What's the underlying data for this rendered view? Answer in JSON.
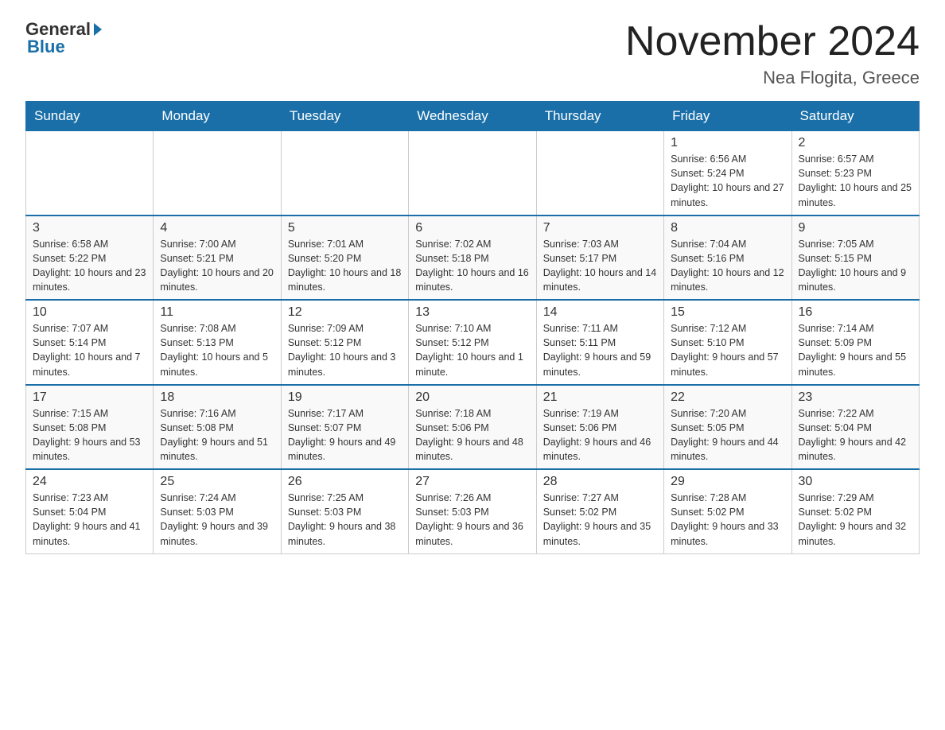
{
  "header": {
    "logo_general": "General",
    "logo_blue": "Blue",
    "month_year": "November 2024",
    "location": "Nea Flogita, Greece"
  },
  "weekdays": [
    "Sunday",
    "Monday",
    "Tuesday",
    "Wednesday",
    "Thursday",
    "Friday",
    "Saturday"
  ],
  "weeks": [
    [
      {
        "day": "",
        "info": ""
      },
      {
        "day": "",
        "info": ""
      },
      {
        "day": "",
        "info": ""
      },
      {
        "day": "",
        "info": ""
      },
      {
        "day": "",
        "info": ""
      },
      {
        "day": "1",
        "info": "Sunrise: 6:56 AM\nSunset: 5:24 PM\nDaylight: 10 hours and 27 minutes."
      },
      {
        "day": "2",
        "info": "Sunrise: 6:57 AM\nSunset: 5:23 PM\nDaylight: 10 hours and 25 minutes."
      }
    ],
    [
      {
        "day": "3",
        "info": "Sunrise: 6:58 AM\nSunset: 5:22 PM\nDaylight: 10 hours and 23 minutes."
      },
      {
        "day": "4",
        "info": "Sunrise: 7:00 AM\nSunset: 5:21 PM\nDaylight: 10 hours and 20 minutes."
      },
      {
        "day": "5",
        "info": "Sunrise: 7:01 AM\nSunset: 5:20 PM\nDaylight: 10 hours and 18 minutes."
      },
      {
        "day": "6",
        "info": "Sunrise: 7:02 AM\nSunset: 5:18 PM\nDaylight: 10 hours and 16 minutes."
      },
      {
        "day": "7",
        "info": "Sunrise: 7:03 AM\nSunset: 5:17 PM\nDaylight: 10 hours and 14 minutes."
      },
      {
        "day": "8",
        "info": "Sunrise: 7:04 AM\nSunset: 5:16 PM\nDaylight: 10 hours and 12 minutes."
      },
      {
        "day": "9",
        "info": "Sunrise: 7:05 AM\nSunset: 5:15 PM\nDaylight: 10 hours and 9 minutes."
      }
    ],
    [
      {
        "day": "10",
        "info": "Sunrise: 7:07 AM\nSunset: 5:14 PM\nDaylight: 10 hours and 7 minutes."
      },
      {
        "day": "11",
        "info": "Sunrise: 7:08 AM\nSunset: 5:13 PM\nDaylight: 10 hours and 5 minutes."
      },
      {
        "day": "12",
        "info": "Sunrise: 7:09 AM\nSunset: 5:12 PM\nDaylight: 10 hours and 3 minutes."
      },
      {
        "day": "13",
        "info": "Sunrise: 7:10 AM\nSunset: 5:12 PM\nDaylight: 10 hours and 1 minute."
      },
      {
        "day": "14",
        "info": "Sunrise: 7:11 AM\nSunset: 5:11 PM\nDaylight: 9 hours and 59 minutes."
      },
      {
        "day": "15",
        "info": "Sunrise: 7:12 AM\nSunset: 5:10 PM\nDaylight: 9 hours and 57 minutes."
      },
      {
        "day": "16",
        "info": "Sunrise: 7:14 AM\nSunset: 5:09 PM\nDaylight: 9 hours and 55 minutes."
      }
    ],
    [
      {
        "day": "17",
        "info": "Sunrise: 7:15 AM\nSunset: 5:08 PM\nDaylight: 9 hours and 53 minutes."
      },
      {
        "day": "18",
        "info": "Sunrise: 7:16 AM\nSunset: 5:08 PM\nDaylight: 9 hours and 51 minutes."
      },
      {
        "day": "19",
        "info": "Sunrise: 7:17 AM\nSunset: 5:07 PM\nDaylight: 9 hours and 49 minutes."
      },
      {
        "day": "20",
        "info": "Sunrise: 7:18 AM\nSunset: 5:06 PM\nDaylight: 9 hours and 48 minutes."
      },
      {
        "day": "21",
        "info": "Sunrise: 7:19 AM\nSunset: 5:06 PM\nDaylight: 9 hours and 46 minutes."
      },
      {
        "day": "22",
        "info": "Sunrise: 7:20 AM\nSunset: 5:05 PM\nDaylight: 9 hours and 44 minutes."
      },
      {
        "day": "23",
        "info": "Sunrise: 7:22 AM\nSunset: 5:04 PM\nDaylight: 9 hours and 42 minutes."
      }
    ],
    [
      {
        "day": "24",
        "info": "Sunrise: 7:23 AM\nSunset: 5:04 PM\nDaylight: 9 hours and 41 minutes."
      },
      {
        "day": "25",
        "info": "Sunrise: 7:24 AM\nSunset: 5:03 PM\nDaylight: 9 hours and 39 minutes."
      },
      {
        "day": "26",
        "info": "Sunrise: 7:25 AM\nSunset: 5:03 PM\nDaylight: 9 hours and 38 minutes."
      },
      {
        "day": "27",
        "info": "Sunrise: 7:26 AM\nSunset: 5:03 PM\nDaylight: 9 hours and 36 minutes."
      },
      {
        "day": "28",
        "info": "Sunrise: 7:27 AM\nSunset: 5:02 PM\nDaylight: 9 hours and 35 minutes."
      },
      {
        "day": "29",
        "info": "Sunrise: 7:28 AM\nSunset: 5:02 PM\nDaylight: 9 hours and 33 minutes."
      },
      {
        "day": "30",
        "info": "Sunrise: 7:29 AM\nSunset: 5:02 PM\nDaylight: 9 hours and 32 minutes."
      }
    ]
  ]
}
